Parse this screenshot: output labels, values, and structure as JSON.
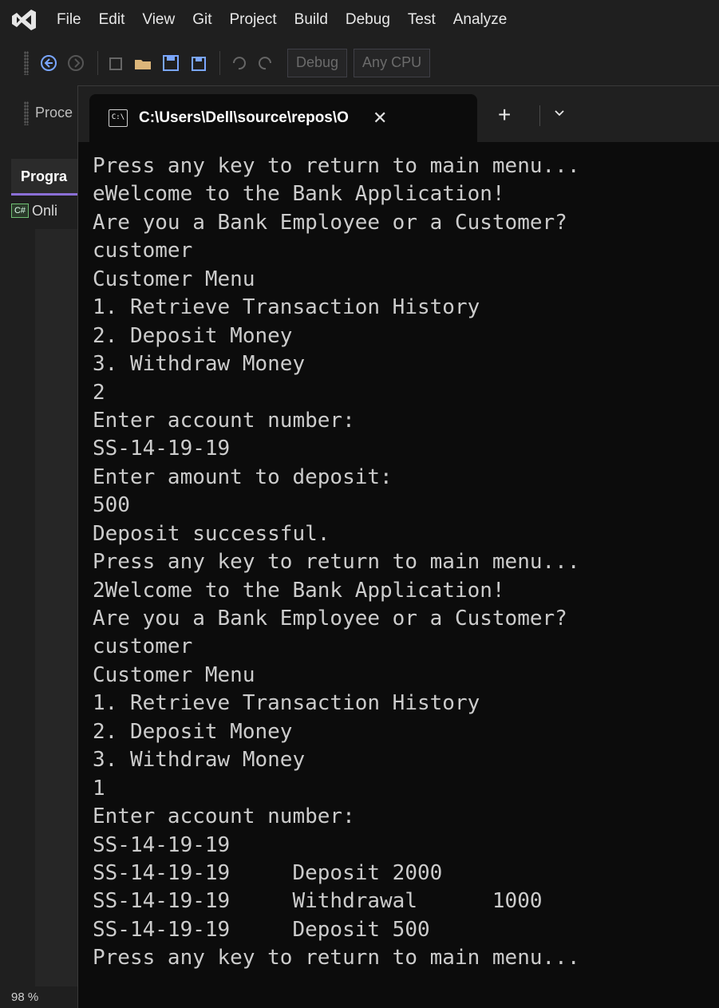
{
  "menubar": {
    "items": [
      "File",
      "Edit",
      "View",
      "Git",
      "Project",
      "Build",
      "Debug",
      "Test",
      "Analyze"
    ]
  },
  "toolbar": {
    "config_combo": "Debug",
    "platform_combo": "Any CPU"
  },
  "toolbar2": {
    "process_label": "Proce"
  },
  "left_panel": {
    "tab_label": "Progra",
    "file_icon_label": "C#",
    "file_label": "Onli",
    "zoom": "98 %"
  },
  "terminal": {
    "tab_title": "C:\\Users\\Dell\\source\\repos\\O",
    "close_glyph": "✕",
    "new_tab_glyph": "+",
    "dropdown_glyph": "⌄",
    "lines": [
      "Press any key to return to main menu...",
      "eWelcome to the Bank Application!",
      "Are you a Bank Employee or a Customer?",
      "customer",
      "Customer Menu",
      "1. Retrieve Transaction History",
      "2. Deposit Money",
      "3. Withdraw Money",
      "2",
      "Enter account number:",
      "SS-14-19-19",
      "Enter amount to deposit:",
      "500",
      "Deposit successful.",
      "Press any key to return to main menu...",
      "2Welcome to the Bank Application!",
      "Are you a Bank Employee or a Customer?",
      "customer",
      "Customer Menu",
      "1. Retrieve Transaction History",
      "2. Deposit Money",
      "3. Withdraw Money",
      "1",
      "Enter account number:",
      "SS-14-19-19",
      "SS-14-19-19     Deposit 2000",
      "SS-14-19-19     Withdrawal      1000",
      "SS-14-19-19     Deposit 500",
      "Press any key to return to main menu..."
    ]
  }
}
